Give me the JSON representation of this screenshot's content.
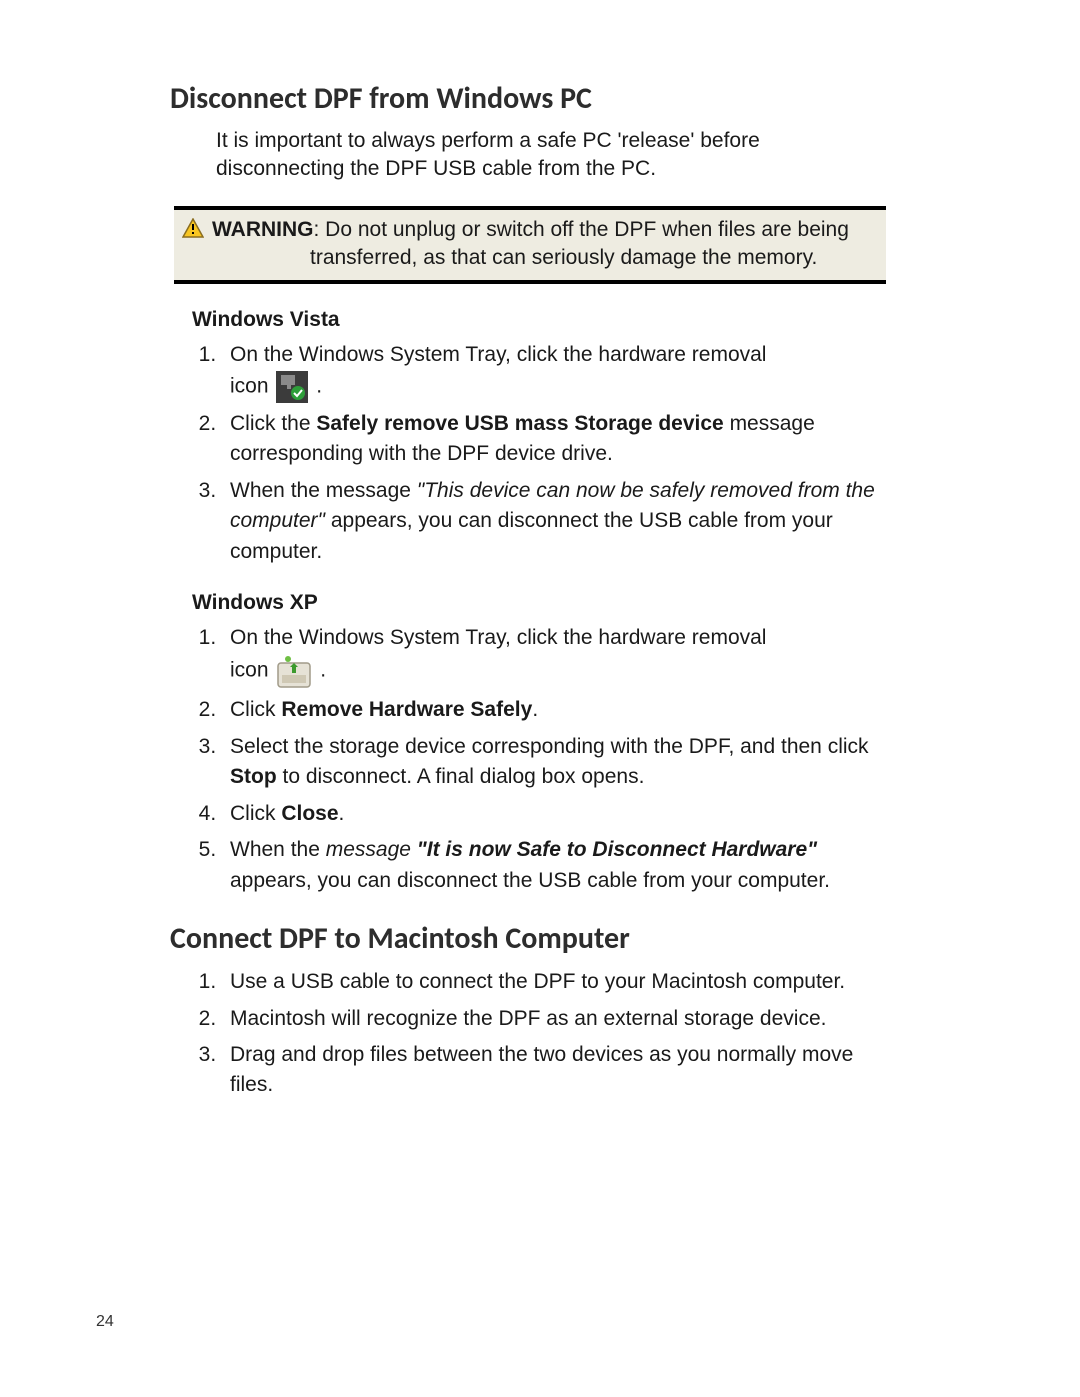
{
  "section1": {
    "title": "Disconnect DPF from Windows PC",
    "intro": "It is important to always perform a safe PC 'release' before disconnecting the DPF USB cable from the PC.",
    "warning": {
      "label": "WARNING",
      "line1": ": Do not unplug or switch off the DPF when files are being",
      "line2": "transferred, as that can seriously damage the memory."
    },
    "vista": {
      "heading": "Windows Vista",
      "step1_a": "On the Windows System Tray, click the hardware removal",
      "step1_b": "icon ",
      "step1_c": ".",
      "step2_a": "Click the ",
      "step2_b": "Safely remove USB mass Storage device",
      "step2_c": " message corresponding with the DPF device drive.",
      "step3_a": "When the message ",
      "step3_b": "\"This device can now be safely removed from the computer\"",
      "step3_c": " appears, you can disconnect the USB cable from your computer."
    },
    "xp": {
      "heading": "Windows XP",
      "step1_a": "On the Windows System Tray, click the hardware removal",
      "step1_b": "icon ",
      "step1_c": ".",
      "step2_a": "Click ",
      "step2_b": "Remove Hardware Safely",
      "step2_c": ".",
      "step3_a": "Select the storage device corresponding with the DPF, and then click ",
      "step3_b": "Stop",
      "step3_c": " to disconnect. A final dialog box opens.",
      "step4_a": "Click ",
      "step4_b": "Close",
      "step4_c": ".",
      "step5_a": "When the ",
      "step5_b": "message ",
      "step5_c": "\"It is now Safe to Disconnect Hardware\"",
      "step5_d": " appears, you can disconnect the USB cable from your computer."
    }
  },
  "section2": {
    "title": "Connect DPF to Macintosh Computer",
    "step1": "Use a USB cable to connect the DPF to your Macintosh computer.",
    "step2": "Macintosh will recognize the DPF as an external storage device.",
    "step3": "Drag and drop files between the two devices as you normally move files."
  },
  "pageNumber": "24"
}
